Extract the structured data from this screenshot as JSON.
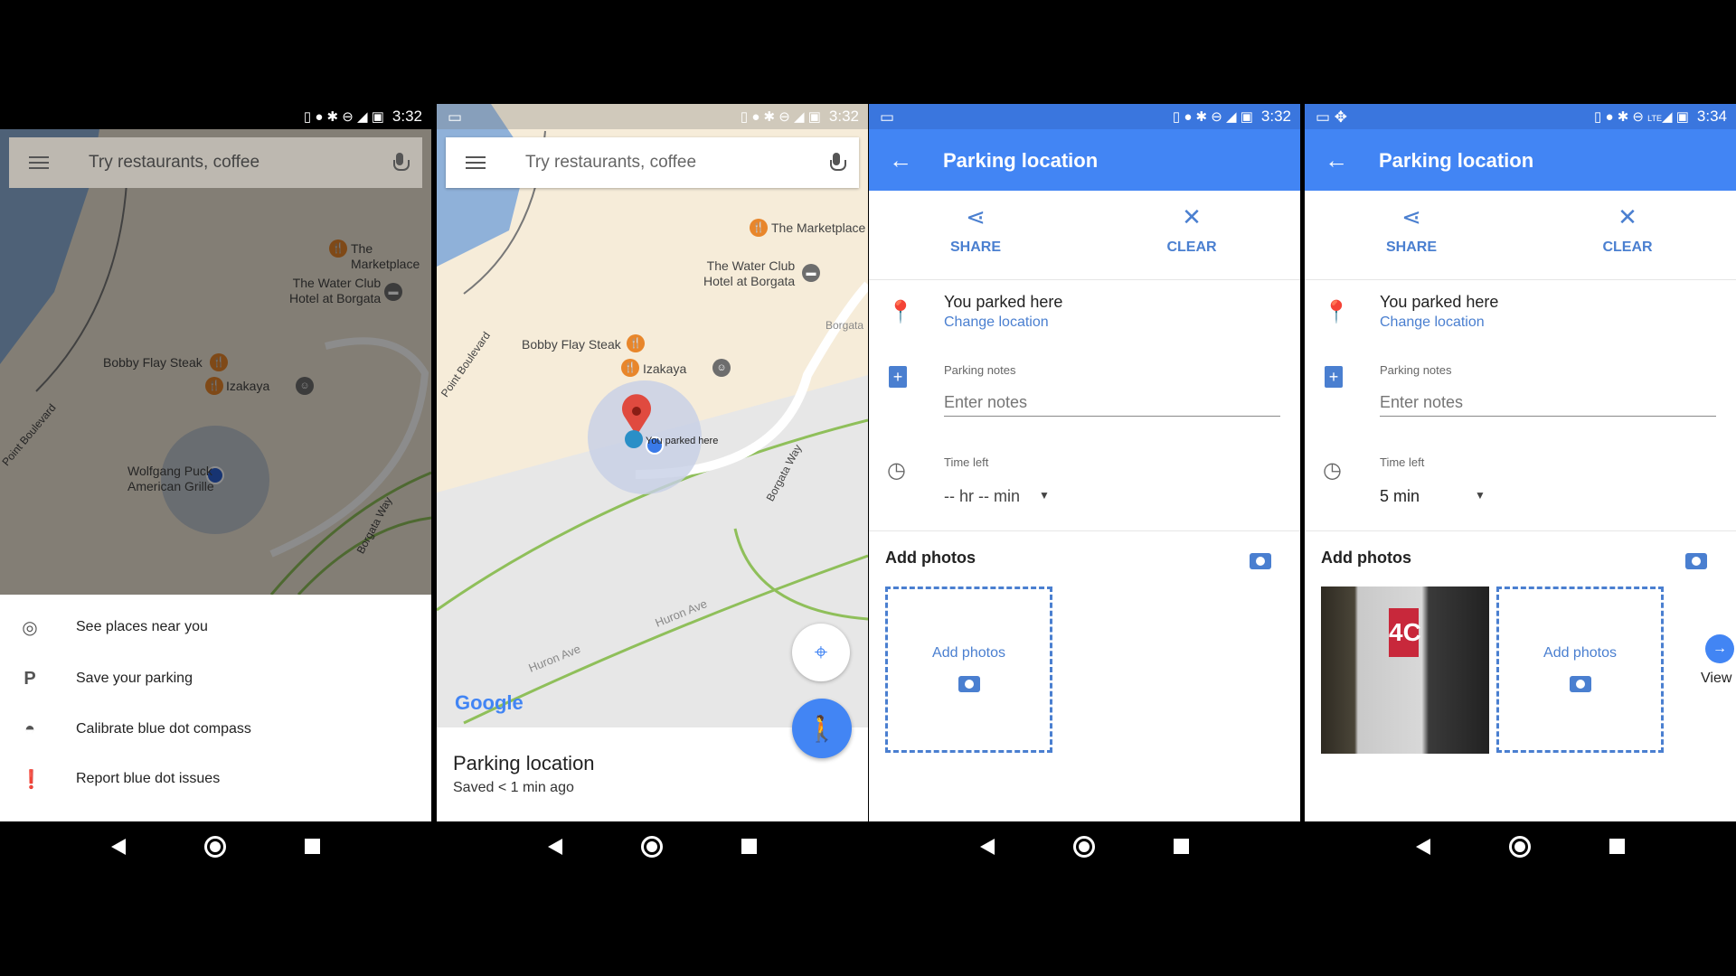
{
  "status": {
    "time_1": "3:32",
    "time_2": "3:32",
    "time_3": "3:32",
    "time_4": "3:34",
    "network_4": "LTE"
  },
  "search": {
    "placeholder": "Try restaurants, coffee"
  },
  "map": {
    "places": [
      "The Marketplace",
      "The Water Club",
      "Hotel at Borgata",
      "Bobby Flay Steak",
      "Izakaya",
      "Wolfgang Puck",
      "American Grille"
    ],
    "streets": [
      "Point Boulevard",
      "Borgata Way",
      "Huron Ave",
      "Huron Ave",
      "Borgata"
    ],
    "parked_marker": "You parked here",
    "logo": "Google"
  },
  "panel1": {
    "menu": [
      {
        "label": "See places near you",
        "icon": "target-icon"
      },
      {
        "label": "Save your parking",
        "icon": "parking-p-icon"
      },
      {
        "label": "Calibrate blue dot compass",
        "icon": "compass-icon"
      },
      {
        "label": "Report blue dot issues",
        "icon": "feedback-icon"
      }
    ]
  },
  "panel2": {
    "sheet_title": "Parking location",
    "sheet_subtitle": "Saved < 1 min ago"
  },
  "details": {
    "title": "Parking location",
    "share": "SHARE",
    "clear": "CLEAR",
    "parked": "You parked here",
    "change_location": "Change location",
    "notes_label": "Parking notes",
    "notes_placeholder": "Enter notes",
    "time_label": "Time left",
    "add_photos_heading": "Add photos",
    "add_photos_box": "Add photos"
  },
  "panel3": {
    "time_value": "-- hr -- min"
  },
  "panel4": {
    "time_value": "5 min",
    "photo_sign": "4C",
    "view_all": "View a"
  },
  "colors": {
    "blue": "#4285f4",
    "accent": "#4a7fd0",
    "poi": "#e8862b"
  }
}
